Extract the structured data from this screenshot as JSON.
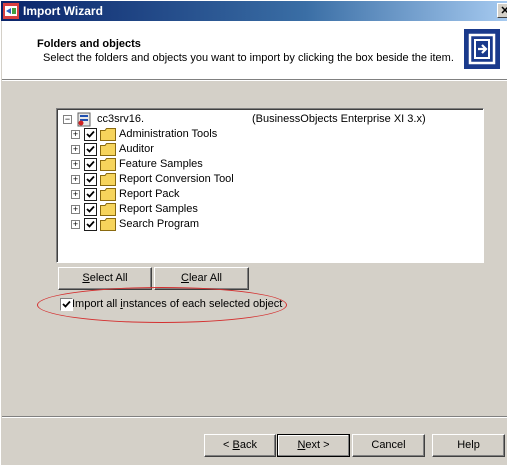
{
  "window": {
    "title": "Import Wizard",
    "close_glyph": "✕",
    "icon": "import-wizard-icon"
  },
  "header": {
    "title": "Folders and objects",
    "subtitle": "Select the folders and objects you want to import by clicking the box beside the item.",
    "icon": "wizard-arrow-icon"
  },
  "tree": {
    "root": {
      "name": "cc3srv16.",
      "product": "(BusinessObjects Enterprise XI 3.x)",
      "expand_glyph": "−",
      "icon": "server-icon"
    },
    "expand_glyph": "+",
    "items": [
      {
        "label": "Administration Tools",
        "checked": true
      },
      {
        "label": "Auditor",
        "checked": true
      },
      {
        "label": "Feature Samples",
        "checked": true
      },
      {
        "label": "Report Conversion Tool",
        "checked": true
      },
      {
        "label": "Report Pack",
        "checked": true
      },
      {
        "label": "Report Samples",
        "checked": true
      },
      {
        "label": "Search Program",
        "checked": true
      }
    ]
  },
  "buttons": {
    "select_all": {
      "pre": "",
      "key": "S",
      "post": "elect All"
    },
    "clear_all": {
      "pre": "",
      "key": "C",
      "post": "lear All"
    },
    "back": {
      "pre": "< ",
      "key": "B",
      "post": "ack"
    },
    "next": {
      "pre": "",
      "key": "N",
      "post": "ext >"
    },
    "cancel": "Cancel",
    "help": "Help"
  },
  "import_instances": {
    "pre": "Import all ",
    "key": "i",
    "post": "nstances of each selected object",
    "checked": true
  },
  "colors": {
    "highlight_ellipse": "#d43030",
    "folder": "#f6d45c",
    "title_bar": "#0a246a"
  }
}
